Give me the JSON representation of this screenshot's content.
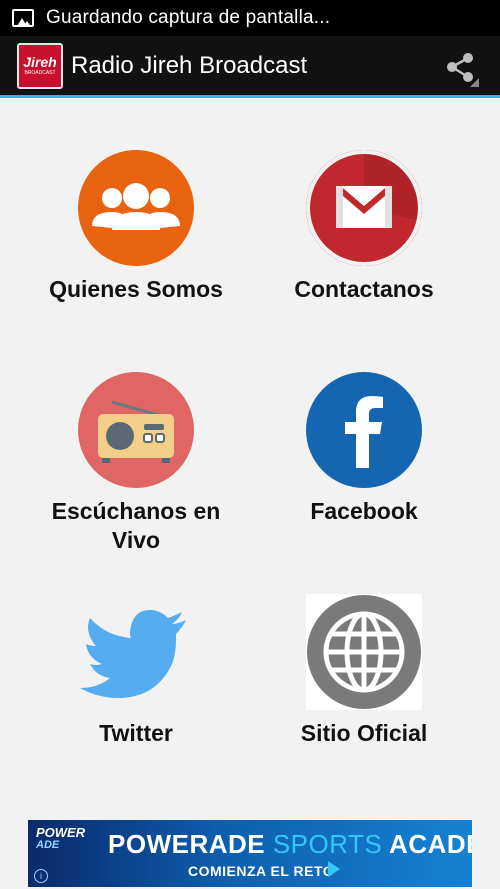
{
  "status_bar": {
    "notification_icon": "image-icon",
    "text": "Guardando captura de pantalla..."
  },
  "action_bar": {
    "logo_text": "Jireh",
    "logo_subtext": "BROADCAST",
    "title": "Radio Jireh Broadcast",
    "share_icon": "share-icon",
    "accent_color": "#33b5e5"
  },
  "menu": {
    "items": [
      {
        "label": "Quienes Somos",
        "icon": "people-icon",
        "color": "#e8620f"
      },
      {
        "label": "Contactanos",
        "icon": "gmail-icon",
        "color": "#c0282d"
      },
      {
        "label": "Escúchanos en Vivo",
        "icon": "radio-icon",
        "color": "#e06565"
      },
      {
        "label": "Facebook",
        "icon": "facebook-icon",
        "color": "#1565b0"
      },
      {
        "label": "Twitter",
        "icon": "twitter-bird-icon",
        "color": "#55acee"
      },
      {
        "label": "Sitio Oficial",
        "icon": "globe-icon",
        "color": "#7a7a7a"
      }
    ]
  },
  "ad": {
    "brand_line1": "POWER",
    "brand_line2": "ADE",
    "headline_part1": "POWERADE ",
    "headline_part2": "SPORTS",
    "headline_part3": " ACADEMY",
    "cta": "COMIENZA EL RETO",
    "info_label": "i"
  }
}
